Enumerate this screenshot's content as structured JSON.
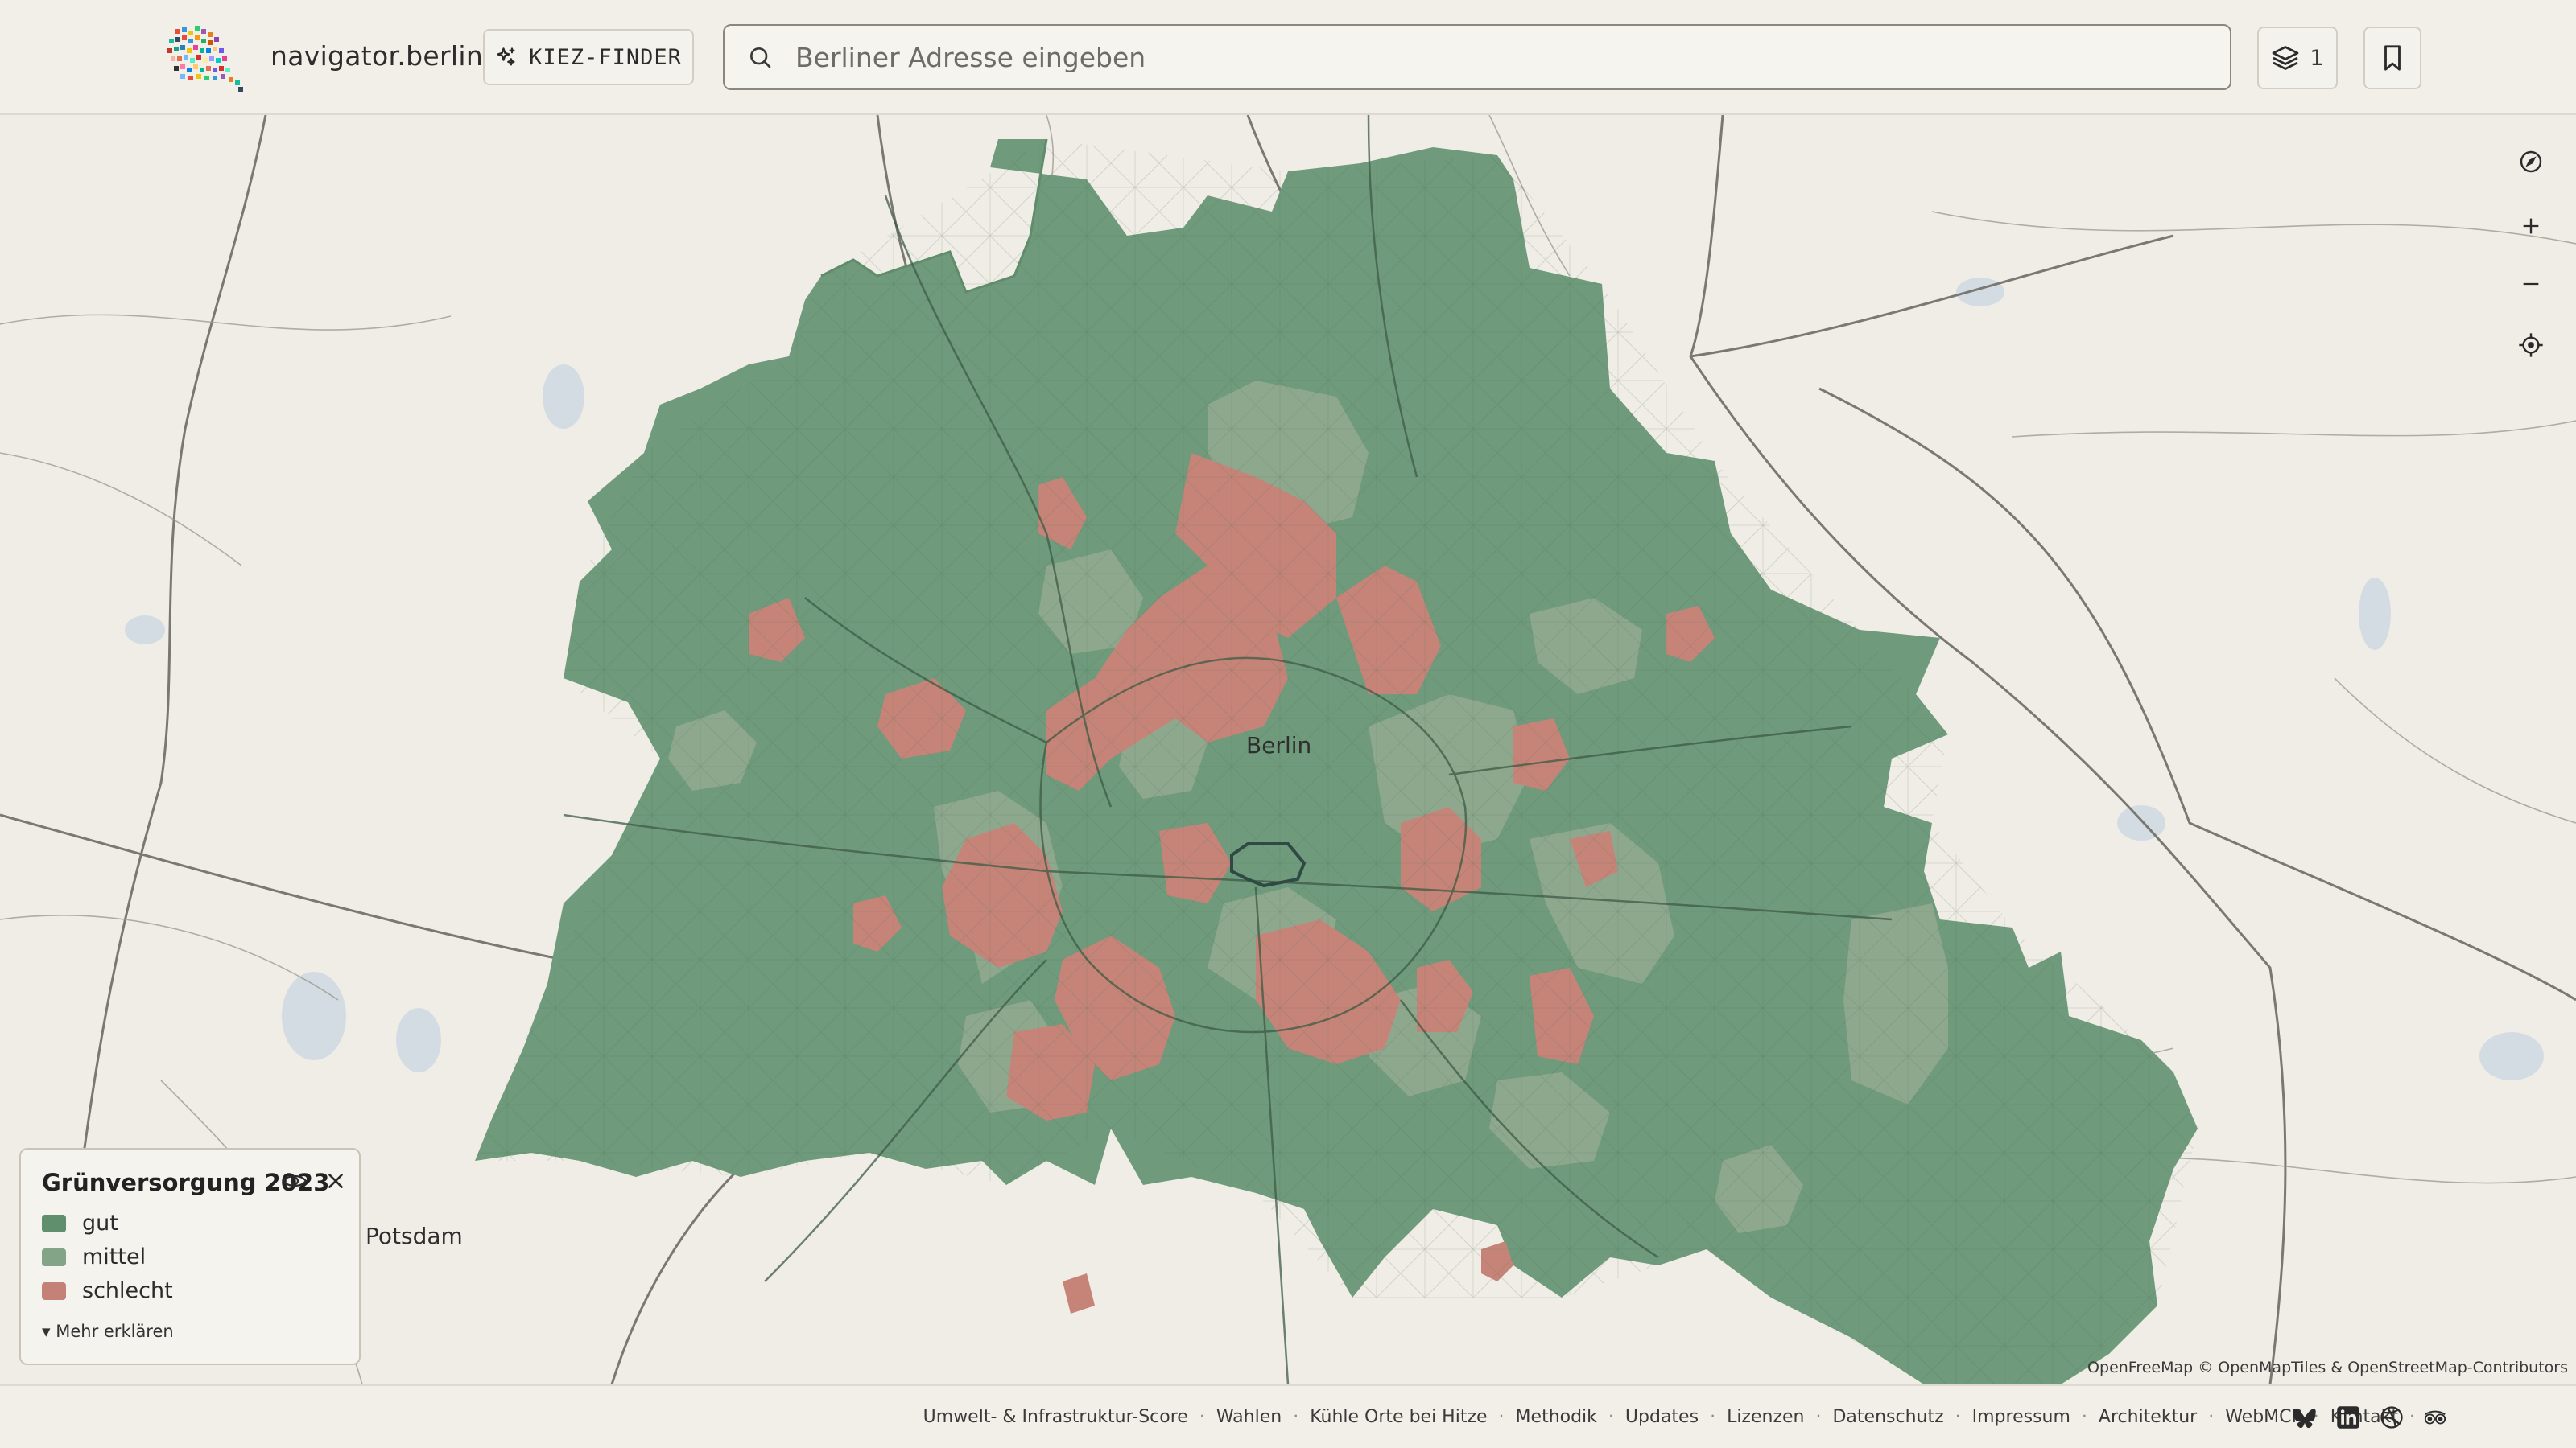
{
  "header": {
    "brand": "navigator.berlin",
    "kiez_finder_label": "KIEZ-FINDER",
    "search_placeholder": "Berliner Adresse eingeben",
    "layers_count": "1"
  },
  "map": {
    "city_label": "Berlin",
    "place_labels": [
      "Potsdam"
    ],
    "attribution": "OpenFreeMap © OpenMapTiles & OpenStreetMap-Contributors",
    "colors": {
      "gut": "#6e9a7b",
      "mittel": "#8fa98f",
      "schlecht": "#c68478",
      "land": "#efede5",
      "water": "#cfd8e0",
      "road": "#6f6e69"
    }
  },
  "legend": {
    "title": "Grünversorgung 2023",
    "items": [
      {
        "label": "gut",
        "color": "#5f8f6c"
      },
      {
        "label": "mittel",
        "color": "#84a487"
      },
      {
        "label": "schlecht",
        "color": "#c48177"
      }
    ],
    "more_label": "Mehr erklären"
  },
  "footer": {
    "links": [
      "Umwelt- & Infrastruktur-Score",
      "Wahlen",
      "Kühle Orte bei Hitze",
      "Methodik",
      "Updates",
      "Lizenzen",
      "Datenschutz",
      "Impressum",
      "Architektur",
      "WebMCP",
      "Kontakt"
    ],
    "social_icons": [
      "bluesky-icon",
      "linkedin-icon",
      "dribbble-icon",
      "tripadvisor-icon"
    ]
  }
}
